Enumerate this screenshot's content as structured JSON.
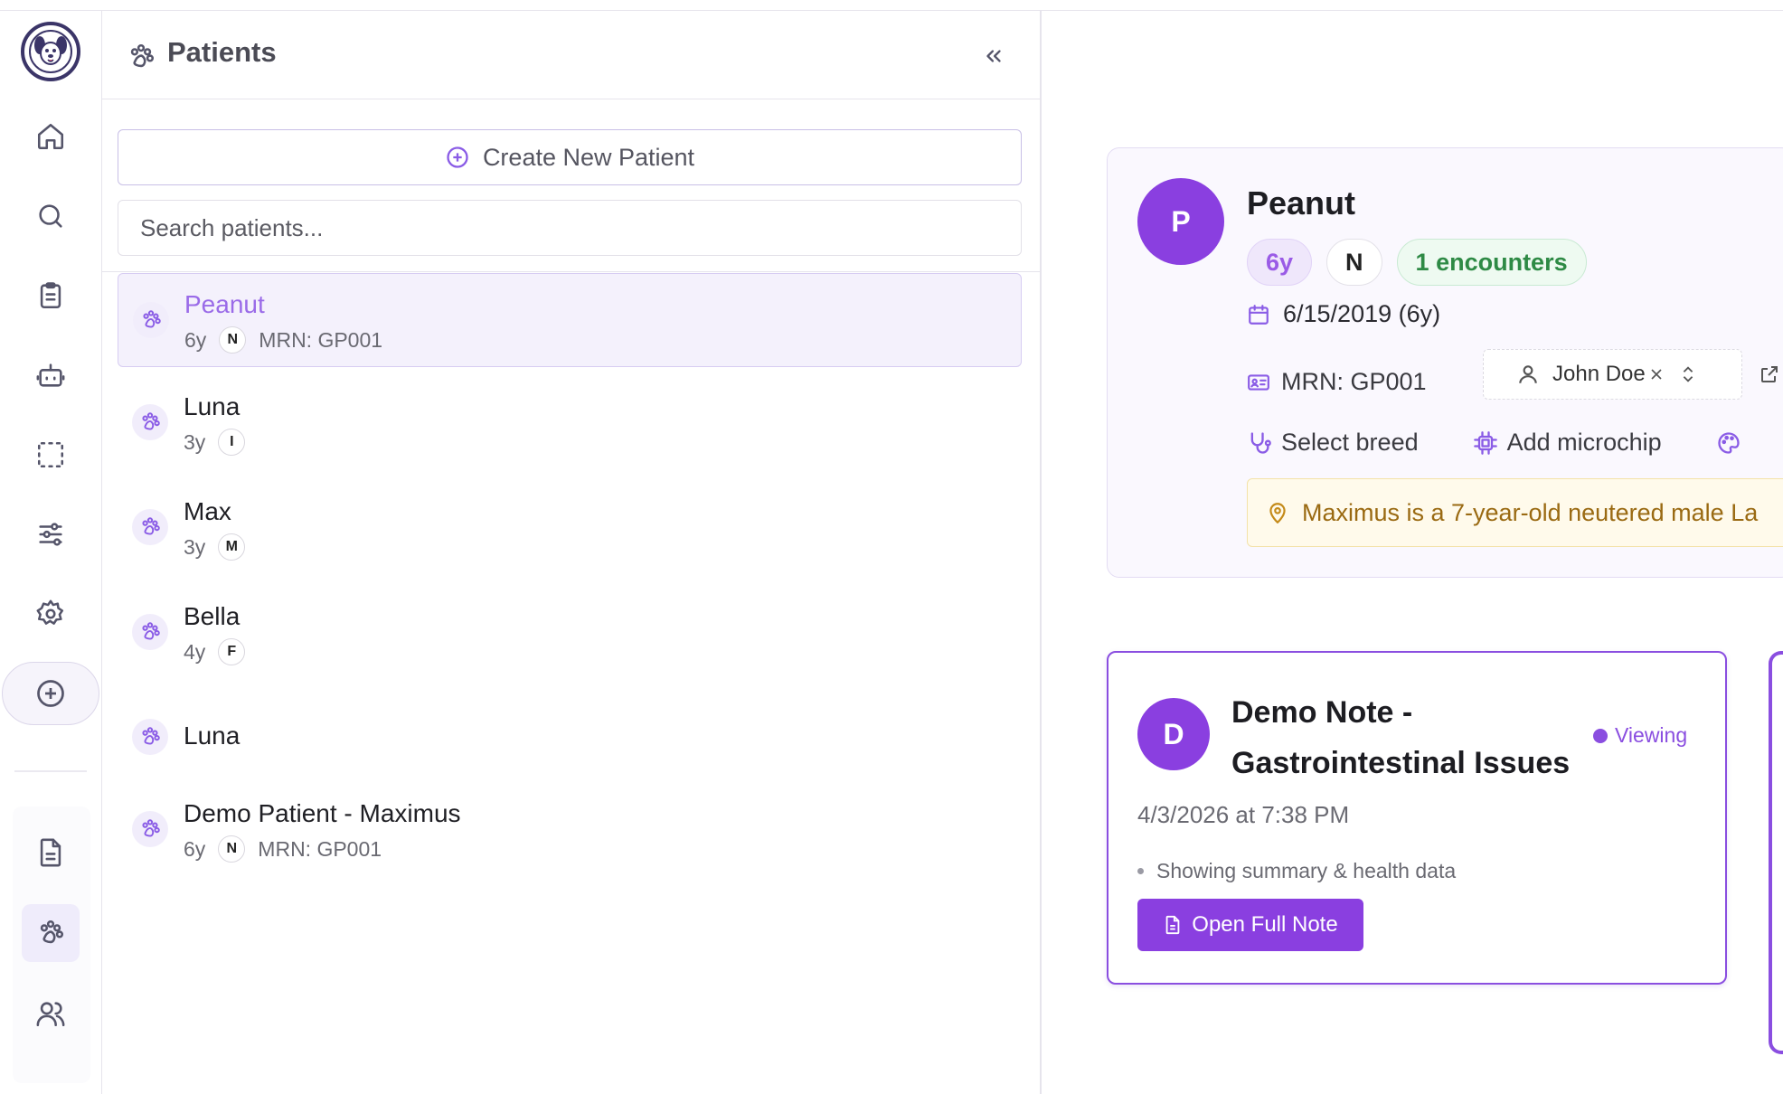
{
  "panel": {
    "title": "Patients",
    "create_label": "Create New Patient",
    "search_placeholder": "Search patients..."
  },
  "patients": [
    {
      "name": "Peanut",
      "age": "6y",
      "sex": "N",
      "mrn": "MRN: GP001",
      "selected": true
    },
    {
      "name": "Luna",
      "age": "3y",
      "sex": "I",
      "mrn": ""
    },
    {
      "name": "Max",
      "age": "3y",
      "sex": "M",
      "mrn": ""
    },
    {
      "name": "Bella",
      "age": "4y",
      "sex": "F",
      "mrn": ""
    },
    {
      "name": "Luna",
      "age": "",
      "sex": "",
      "mrn": ""
    },
    {
      "name": "Demo Patient - Maximus",
      "age": "6y",
      "sex": "N",
      "mrn": "MRN: GP001"
    }
  ],
  "detail": {
    "avatar_letter": "P",
    "name": "Peanut",
    "age_chip": "6y",
    "sex_chip": "N",
    "encounters_chip": "1 encounters",
    "dob": "6/15/2019 (6y)",
    "mrn": "MRN: GP001",
    "owner": "John Doe",
    "select_breed": "Select breed",
    "add_microchip": "Add microchip",
    "summary": "Maximus is a 7-year-old neutered male La"
  },
  "note": {
    "avatar_letter": "D",
    "title": "Demo Note - Gastrointestinal Issues",
    "status": "Viewing",
    "date": "4/3/2026 at 7:38 PM",
    "info": "Showing summary & health data",
    "open_label": "Open Full Note"
  },
  "colors": {
    "accent": "#8a3fe0",
    "accent_light": "#efe7fb",
    "success": "#2e8a45",
    "warning": "#9a6a12"
  }
}
